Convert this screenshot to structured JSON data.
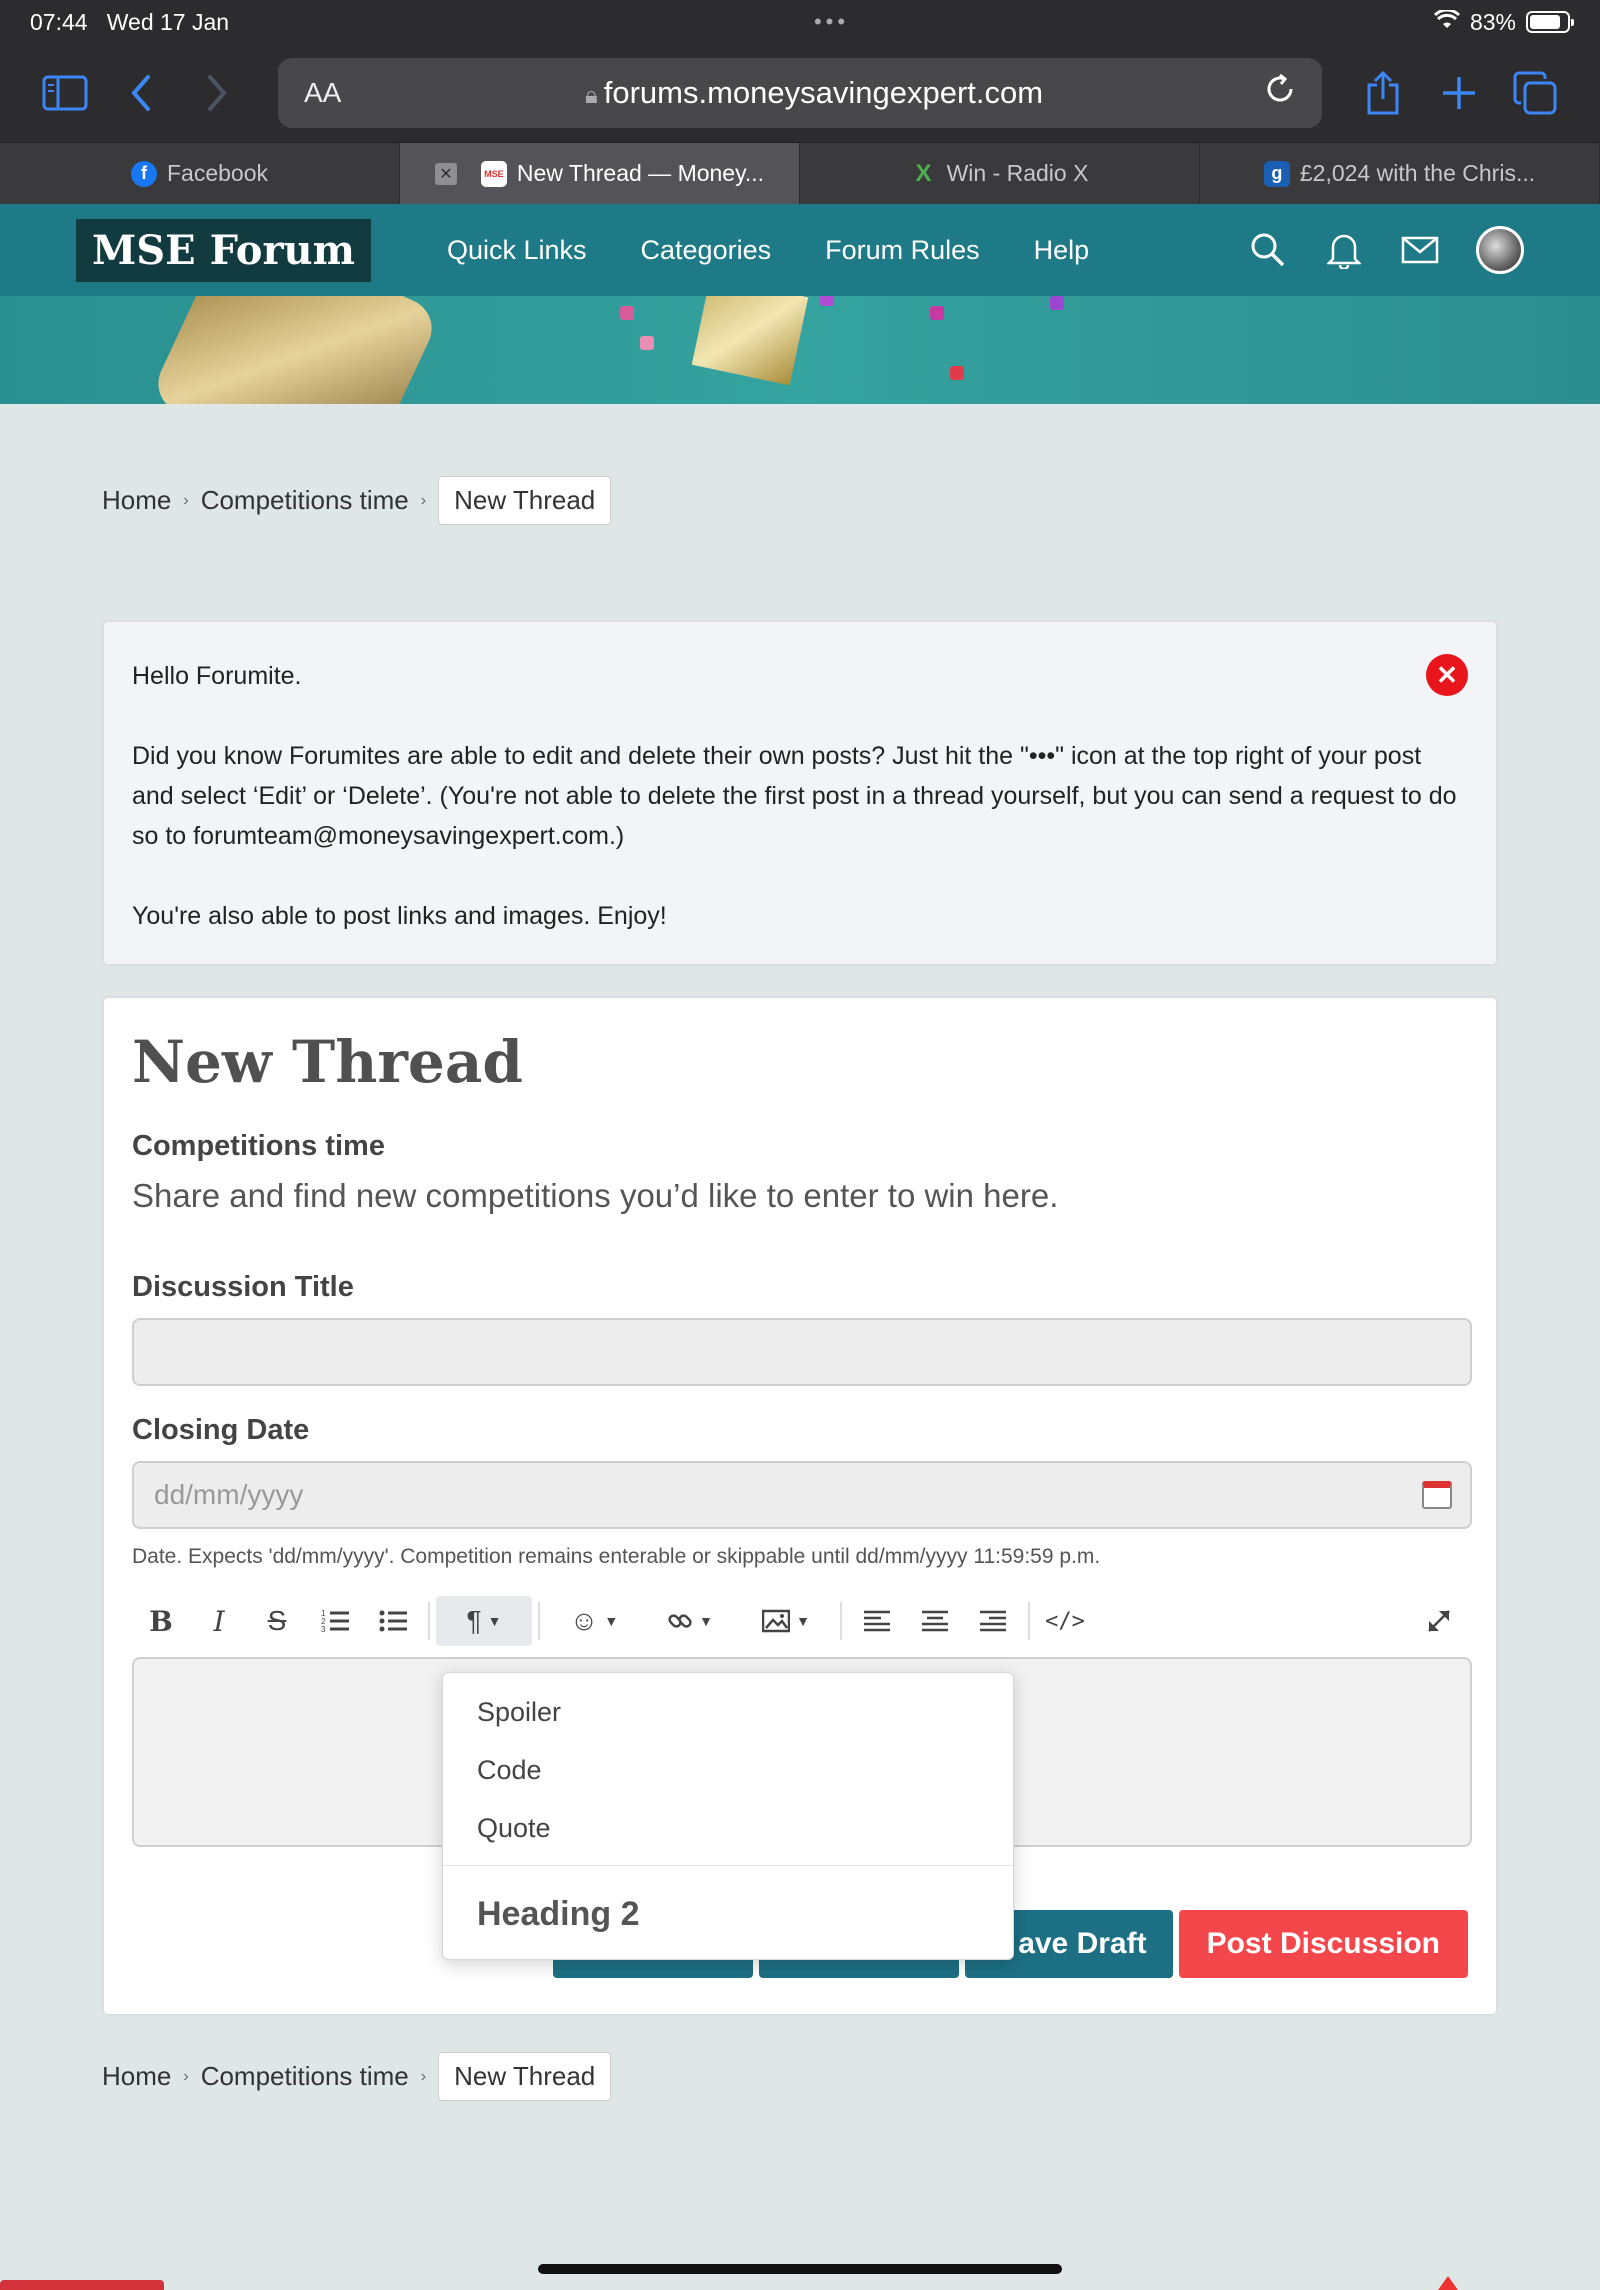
{
  "status_bar": {
    "time": "07:44",
    "date": "Wed 17 Jan",
    "battery": "83%",
    "battery_level": 0.83
  },
  "browser": {
    "text_size_label": "AA",
    "url": "forums.moneysavingexpert.com",
    "tabs": [
      {
        "label": "Facebook",
        "active": false
      },
      {
        "label": "New Thread — Money...",
        "active": true
      },
      {
        "label": "Win - Radio X",
        "active": false
      },
      {
        "label": "£2,024 with the Chris...",
        "active": false
      }
    ]
  },
  "site_nav": {
    "logo": "MSE Forum",
    "links": [
      "Quick Links",
      "Categories",
      "Forum Rules",
      "Help"
    ]
  },
  "breadcrumb": {
    "home": "Home",
    "category": "Competitions time",
    "current": "New Thread"
  },
  "alert": {
    "greeting": "Hello Forumite.",
    "body1": "Did you know Forumites are able to edit and delete their own posts? Just hit the \"•••\" icon at the top right of your post and select ‘Edit’ or ‘Delete’. (You're not able to delete the first post in a thread yourself, but you can send a request to do so to forumteam@moneysavingexpert.com.)",
    "body2": "You're also able to post links and images. Enjoy!"
  },
  "form": {
    "title": "New Thread",
    "category_title": "Competitions time",
    "category_description": "Share and find new competitions you’d like to enter to win here.",
    "discussion_title_label": "Discussion Title",
    "discussion_title_value": "",
    "closing_date_label": "Closing Date",
    "closing_date_placeholder": "dd/mm/yyyy",
    "closing_date_help": "Date. Expects 'dd/mm/yyyy'. Competition remains enterable or skippable until dd/mm/yyyy 11:59:59 p.m.",
    "save_draft_label": "ave Draft",
    "post_label": "Post Discussion"
  },
  "format_menu": {
    "items": [
      "Spoiler",
      "Code",
      "Quote"
    ],
    "heading_item": "Heading 2"
  },
  "colors": {
    "nav": "#1e7a86",
    "post_button": "#f3474b",
    "teal_button": "#1d6f83",
    "close_badge": "#e8161c"
  }
}
